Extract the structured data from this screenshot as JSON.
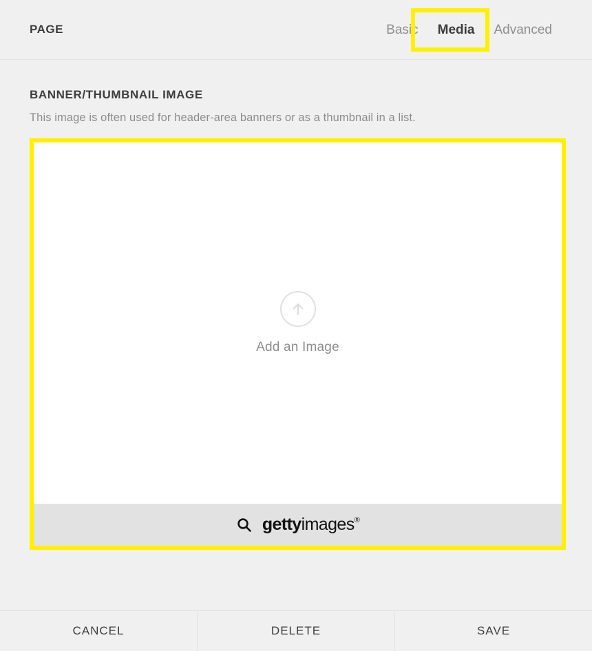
{
  "header": {
    "title": "PAGE",
    "tabs": [
      {
        "label": "Basic",
        "active": false
      },
      {
        "label": "Media",
        "active": true
      },
      {
        "label": "Advanced",
        "active": false
      }
    ],
    "highlight_color": "#fff000"
  },
  "main": {
    "section_title": "BANNER/THUMBNAIL IMAGE",
    "section_description": "This image is often used for header-area banners or as a thumbnail in a list.",
    "dropzone": {
      "icon": "upload-arrow-circle-icon",
      "label": "Add an Image",
      "highlight_color": "#fff000",
      "background": "#ffffff"
    },
    "getty": {
      "search_icon": "search-icon",
      "brand_bold": "getty",
      "brand_light": "images",
      "registered_mark": "®",
      "bar_background": "#e2e2e2"
    }
  },
  "footer": {
    "buttons": [
      {
        "label": "CANCEL"
      },
      {
        "label": "DELETE"
      },
      {
        "label": "SAVE"
      }
    ]
  }
}
